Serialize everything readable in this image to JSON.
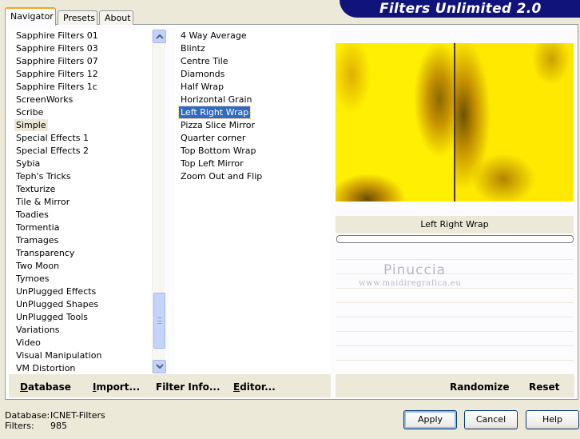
{
  "app": {
    "title": "Filters Unlimited 2.0"
  },
  "tabs": [
    "Navigator",
    "Presets",
    "About"
  ],
  "categories": {
    "items": [
      "Sapphire Filters 01",
      "Sapphire Filters 03",
      "Sapphire Filters 07",
      "Sapphire Filters 12",
      "Sapphire Filters 1c",
      "ScreenWorks",
      "Scribe",
      "Simple",
      "Special Effects 1",
      "Special Effects 2",
      "Sybia",
      "Teph's Tricks",
      "Texturize",
      "Tile & Mirror",
      "Toadies",
      "Tormentia",
      "Tramages",
      "Transparency",
      "Two Moon",
      "Tymoes",
      "UnPlugged Effects",
      "UnPlugged Shapes",
      "UnPlugged Tools",
      "Variations",
      "Video",
      "Visual Manipulation",
      "VM Distortion"
    ],
    "selected": "Simple"
  },
  "filters": {
    "items": [
      "4 Way Average",
      "Blintz",
      "Centre Tile",
      "Diamonds",
      "Half Wrap",
      "Horizontal Grain",
      "Left Right Wrap",
      "Pizza Slice Mirror",
      "Quarter corner",
      "Top Bottom Wrap",
      "Top Left Mirror",
      "Zoom Out and Flip"
    ],
    "selected": "Left Right Wrap"
  },
  "buttons": {
    "database": "Database",
    "import": "Import...",
    "filter_info": "Filter Info...",
    "editor": "Editor...",
    "randomize": "Randomize",
    "reset": "Reset",
    "apply": "Apply",
    "cancel": "Cancel",
    "help": "Help"
  },
  "preview": {
    "filter_name": "Left Right Wrap",
    "progress": 0
  },
  "watermark": {
    "line1": "Pinuccia",
    "line2": "www.maidiregrafica.eu"
  },
  "footer": {
    "database_label": "Database:",
    "database_value": "ICNET-Filters",
    "filters_label": "Filters:",
    "filters_value": "985"
  },
  "colors": {
    "selection": "#316ac5",
    "banner": "#10147a",
    "preview_yellow": "#ffef00"
  }
}
